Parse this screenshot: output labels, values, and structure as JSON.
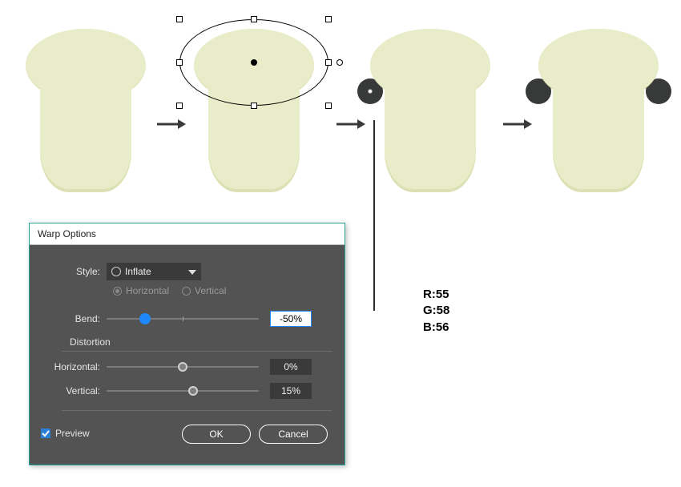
{
  "dialog": {
    "title": "Warp Options",
    "style_label": "Style:",
    "style_value": "Inflate",
    "orientation": {
      "horizontal": "Horizontal",
      "vertical": "Vertical"
    },
    "bend_label": "Bend:",
    "bend_value": "-50%",
    "distortion_label": "Distortion",
    "horizontal_label": "Horizontal:",
    "horizontal_value": "0%",
    "vertical_label": "Vertical:",
    "vertical_value": "15%",
    "preview_label": "Preview",
    "ok_label": "OK",
    "cancel_label": "Cancel"
  },
  "rgb": {
    "r": "R:55",
    "g": "G:58",
    "b": "B:56"
  },
  "colors": {
    "shape_fill": "#E9ECC8",
    "shape_shadow": "#DCE0B5",
    "ear": "#373a38"
  }
}
